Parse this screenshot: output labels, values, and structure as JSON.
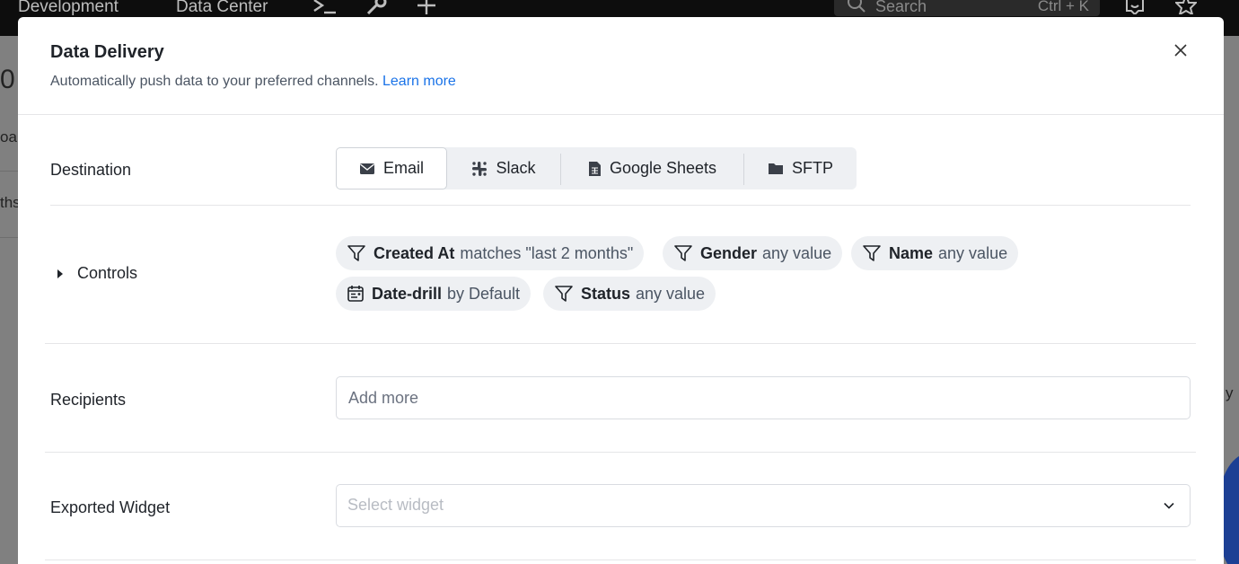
{
  "background": {
    "nav_items": [
      "Development",
      "Data Center"
    ],
    "search_placeholder": "Search",
    "search_shortcut": "Ctrl + K",
    "fragments": {
      "left_top": "0",
      "left_mid": "oar",
      "left_low": "ths",
      "right_mid": "y"
    }
  },
  "modal": {
    "title": "Data Delivery",
    "subtitle": "Automatically push data to your preferred channels.",
    "learn_more": "Learn more"
  },
  "destination": {
    "label": "Destination",
    "options": [
      {
        "label": "Email",
        "icon": "envelope-icon",
        "active": true
      },
      {
        "label": "Slack",
        "icon": "slack-icon",
        "active": false
      },
      {
        "label": "Google Sheets",
        "icon": "sheet-icon",
        "active": false
      },
      {
        "label": "SFTP",
        "icon": "folder-icon",
        "active": false
      }
    ]
  },
  "controls": {
    "label": "Controls",
    "chips": [
      {
        "name": "Created At",
        "value": "matches \"last 2 months\"",
        "icon": "filter-icon"
      },
      {
        "name": "Gender",
        "value": "any value",
        "icon": "filter-icon"
      },
      {
        "name": "Name",
        "value": "any value",
        "icon": "filter-icon"
      },
      {
        "name": "Date-drill",
        "value": "by Default",
        "icon": "calendar-icon"
      },
      {
        "name": "Status",
        "value": "any value",
        "icon": "filter-icon"
      }
    ]
  },
  "recipients": {
    "label": "Recipients",
    "placeholder": "Add more"
  },
  "exported_widget": {
    "label": "Exported Widget",
    "placeholder": "Select widget"
  }
}
